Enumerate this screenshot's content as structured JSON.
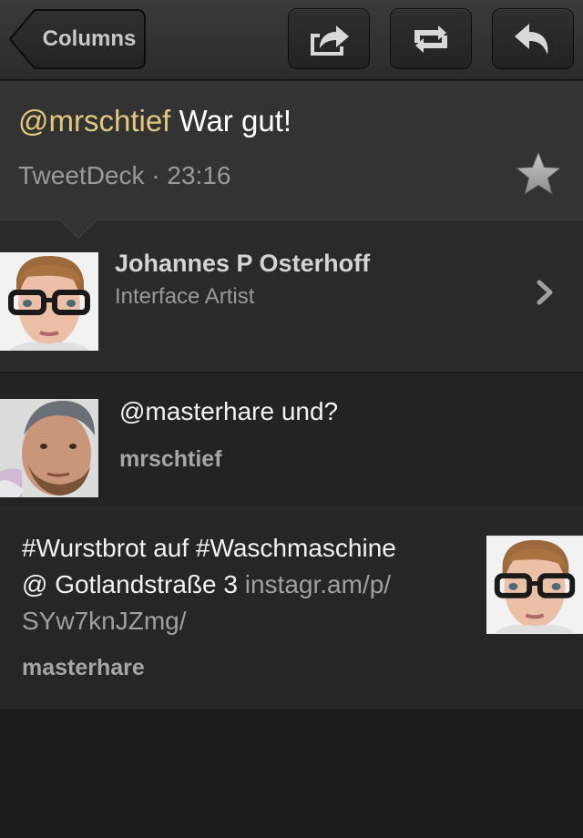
{
  "toolbar": {
    "back_label": "Columns",
    "share_icon": "share-icon",
    "retweet_icon": "retweet-icon",
    "reply_icon": "reply-icon"
  },
  "tweet": {
    "mention": "@mrschtief",
    "text": " War gut!",
    "source": "TweetDeck",
    "separator": " · ",
    "time": "23:16",
    "favorite_icon": "star-icon"
  },
  "profile": {
    "name": "Johannes P Osterhoff",
    "bio": "Interface Artist"
  },
  "conversation": [
    {
      "text": "@masterhare und?",
      "author": "mrschtief"
    },
    {
      "text_line1": "#Wurstbrot auf #Waschmaschine",
      "text_line2a": "@ Gotlandstraße 3 ",
      "link_part1": "instagr.am/p/",
      "link_part2": "SYw7knJZmg/",
      "author": "masterhare"
    }
  ],
  "colors": {
    "mention": "#e4c77f",
    "detail_bg": "#333333",
    "list_bg": "#232323",
    "muted_text": "#9a9a9a"
  }
}
